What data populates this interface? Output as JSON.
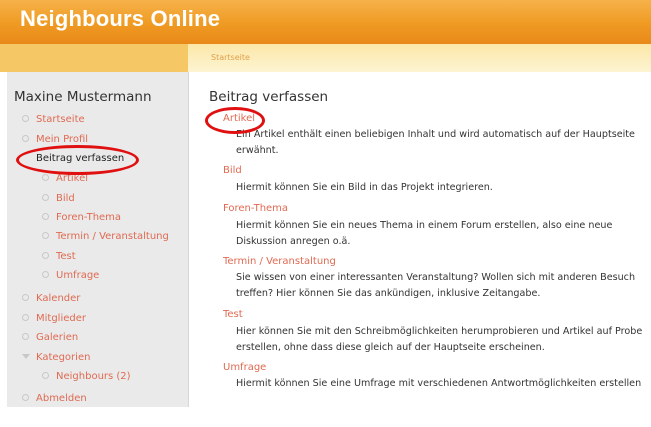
{
  "header": {
    "site_title": "Neighbours Online"
  },
  "breadcrumb": "Startseite",
  "sidebar": {
    "user_name": "Maxine Mustermann",
    "items": [
      {
        "label": "Startseite"
      },
      {
        "label": "Mein Profil"
      },
      {
        "label": "Beitrag verfassen"
      },
      {
        "label": "Artikel"
      },
      {
        "label": "Bild"
      },
      {
        "label": "Foren-Thema"
      },
      {
        "label": "Termin / Veranstaltung"
      },
      {
        "label": "Test"
      },
      {
        "label": "Umfrage"
      },
      {
        "label": "Kalender"
      },
      {
        "label": "Mitglieder"
      },
      {
        "label": "Galerien"
      },
      {
        "label": "Kategorien"
      },
      {
        "label": "Neighbours (2)"
      },
      {
        "label": "Abmelden"
      }
    ]
  },
  "main": {
    "title": "Beitrag verfassen",
    "items": [
      {
        "title": "Artikel",
        "desc": [
          "Ein Artikel enthält einen beliebigen Inhalt und wird automatisch auf der Hauptseite",
          "erwähnt."
        ]
      },
      {
        "title": "Bild",
        "desc": [
          "Hiermit können Sie ein Bild in das Projekt integrieren."
        ]
      },
      {
        "title": "Foren-Thema",
        "desc": [
          "Hiermit können Sie ein neues Thema in einem Forum erstellen, also eine neue",
          "Diskussion anregen o.ä."
        ]
      },
      {
        "title": "Termin / Veranstaltung",
        "desc": [
          "Sie wissen von einer interessanten Veranstaltung? Wollen sich mit anderen Besuch",
          "treffen? Hier können Sie das ankündigen, inklusive Zeitangabe."
        ]
      },
      {
        "title": "Test",
        "desc": [
          "Hier können Sie mit den Schreibmöglichkeiten herumprobieren und Artikel auf Probe",
          "erstellen, ohne dass diese gleich auf der Hauptseite erscheinen."
        ]
      },
      {
        "title": "Umfrage",
        "desc": [
          "Hiermit können Sie eine Umfrage mit verschiedenen Antwortmöglichkeiten erstellen"
        ]
      }
    ]
  },
  "colors": {
    "accent": "#ef9a22",
    "link": "#e06a52",
    "highlight_ring": "#e01010"
  }
}
